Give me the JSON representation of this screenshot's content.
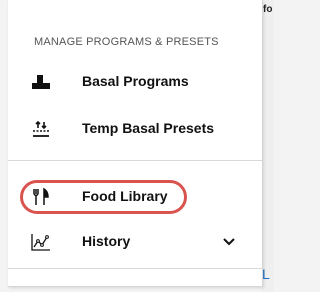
{
  "background": {
    "top_text": "fo",
    "bottom_text": "L"
  },
  "drawer": {
    "section_header": "MANAGE PROGRAMS & PRESETS",
    "items": [
      {
        "label": "Basal Programs",
        "icon": "basal-programs-icon"
      },
      {
        "label": "Temp Basal Presets",
        "icon": "temp-basal-icon"
      },
      {
        "label": "Food Library",
        "icon": "fork-knife-icon",
        "highlighted": true
      },
      {
        "label": "History",
        "icon": "history-chart-icon",
        "expandable": true
      }
    ]
  },
  "colors": {
    "highlight": "#d9534f",
    "text": "#111111"
  }
}
